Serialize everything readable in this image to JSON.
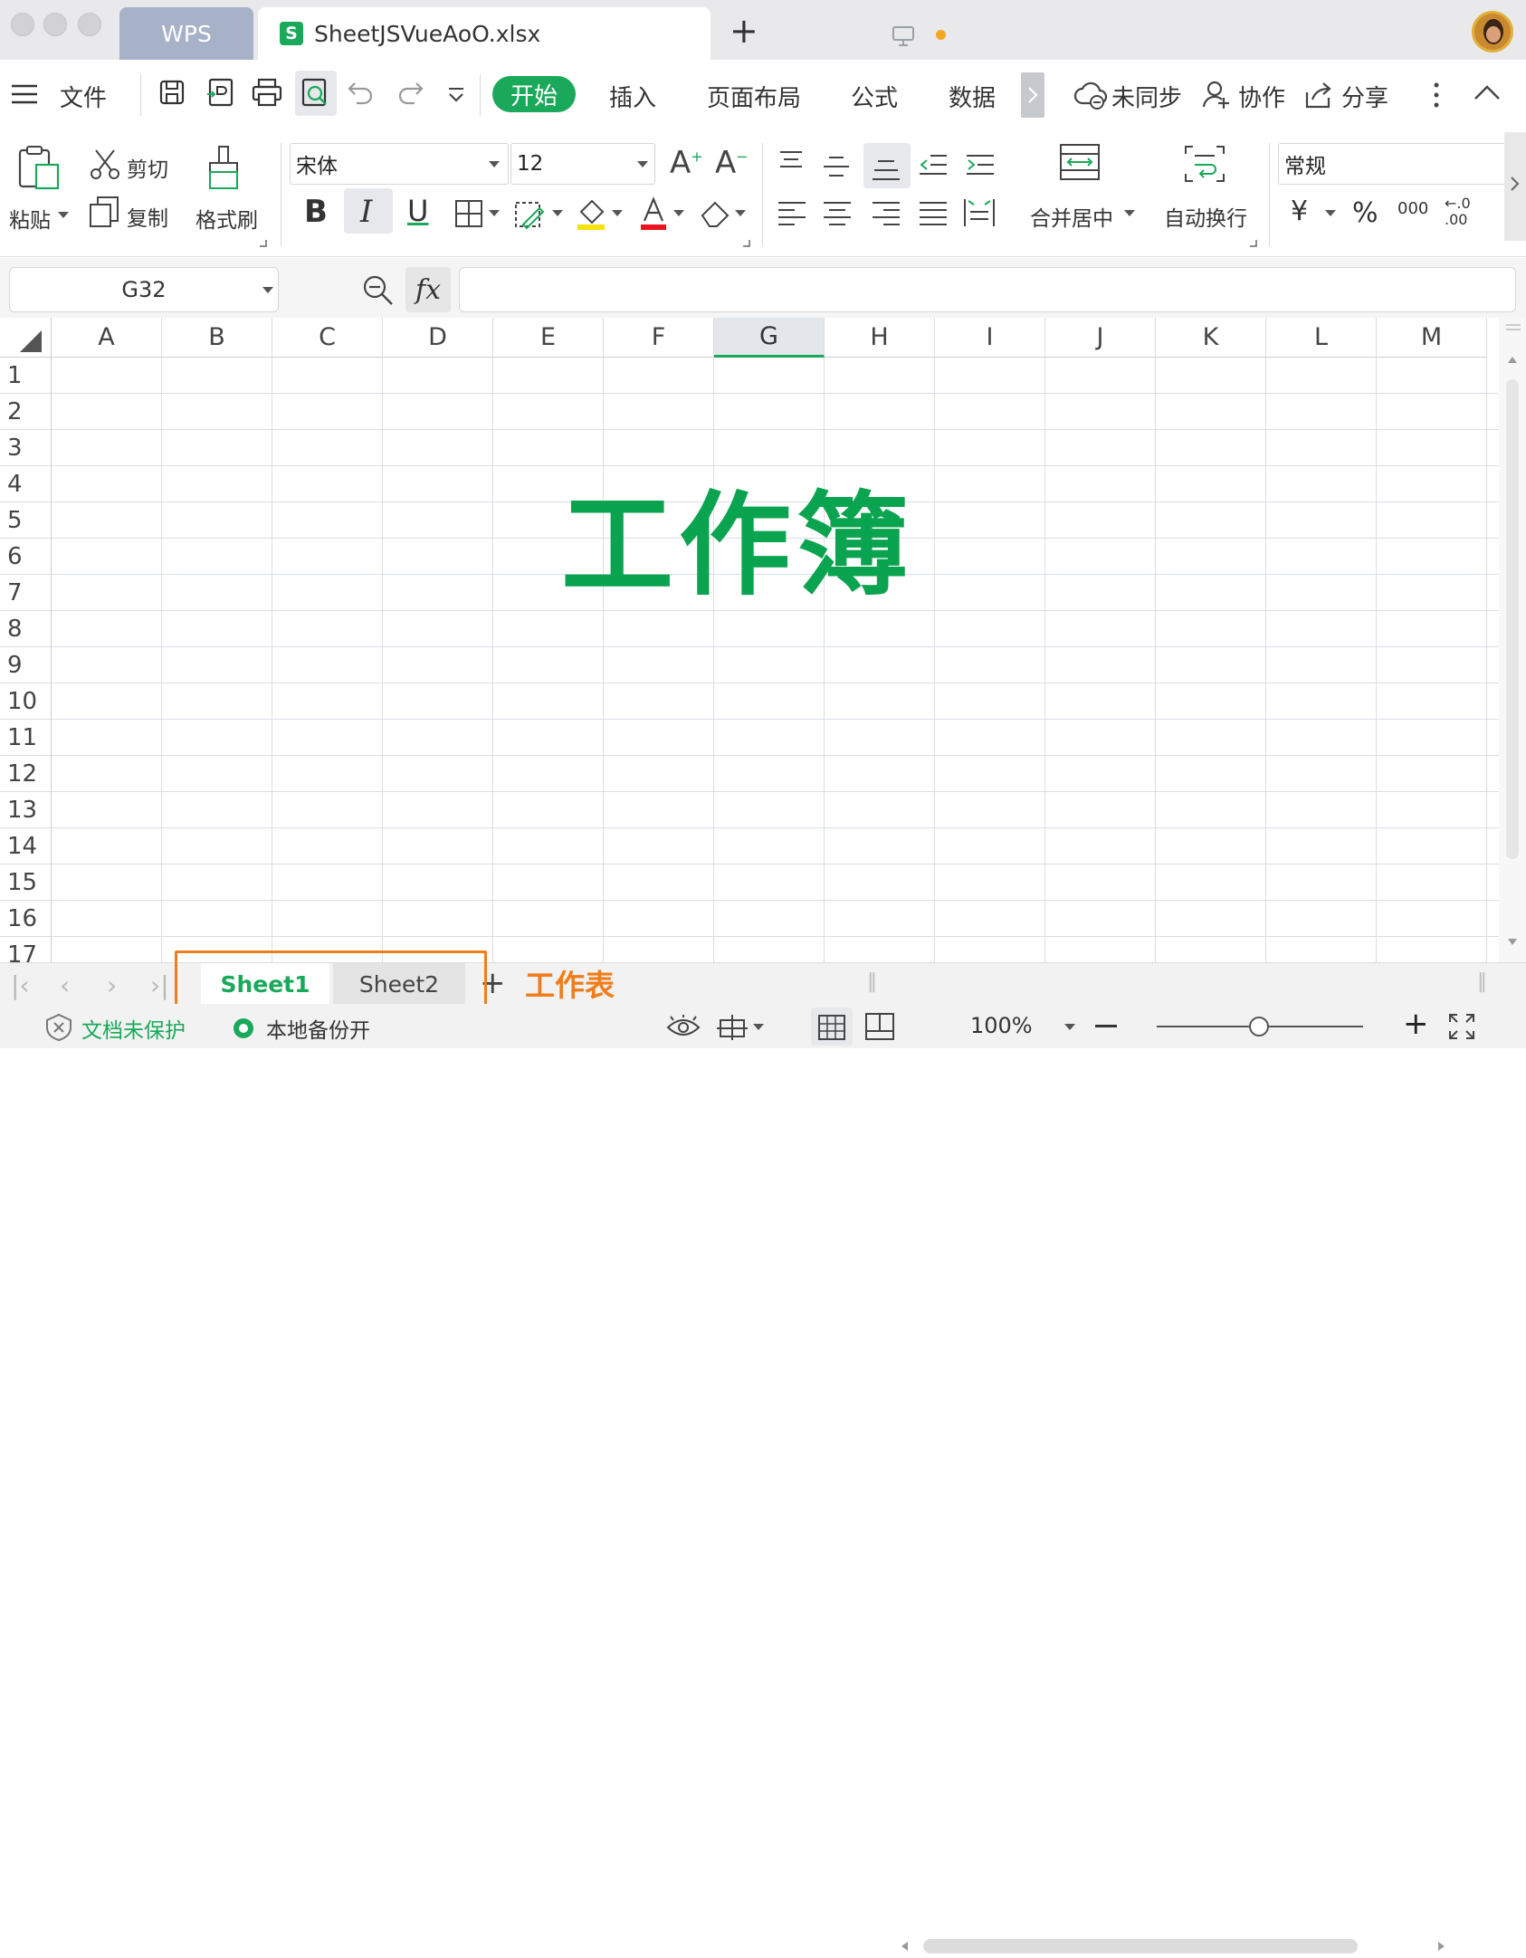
{
  "titlebar": {
    "wps_tab": "WPS",
    "doc_tab": "SheetJSVueAoO.xlsx",
    "doc_icon_letter": "S",
    "new_tab": "+"
  },
  "menu": {
    "file": "文件",
    "tabs": [
      "开始",
      "插入",
      "页面布局",
      "公式",
      "数据"
    ],
    "sync": "未同步",
    "collab": "协作",
    "share": "分享"
  },
  "ribbon": {
    "paste": "粘贴",
    "cut": "剪切",
    "copy": "复制",
    "format_painter": "格式刷",
    "font_name": "宋体",
    "font_size": "12",
    "bold": "B",
    "italic": "I",
    "underline": "U",
    "merge_center": "合并居中",
    "wrap_text": "自动换行",
    "number_format": "常规",
    "currency": "¥",
    "percent": "%",
    "thousands": "000",
    "decimal": "←.0 .00"
  },
  "formula": {
    "name_box": "G32",
    "fx": "fx",
    "content": ""
  },
  "sheet": {
    "columns": [
      "A",
      "B",
      "C",
      "D",
      "E",
      "F",
      "G",
      "H",
      "I",
      "J",
      "K",
      "L",
      "M"
    ],
    "active_column": "G",
    "rows": [
      "1",
      "2",
      "3",
      "4",
      "5",
      "6",
      "7",
      "8",
      "9",
      "10",
      "11",
      "12",
      "13",
      "14",
      "15",
      "16",
      "17"
    ],
    "overlay_title": "工作簿"
  },
  "sheet_tabs": {
    "tabs": [
      "Sheet1",
      "Sheet2"
    ],
    "active": "Sheet1",
    "add": "+",
    "annotation": "工作表"
  },
  "status": {
    "protect": "文档未保护",
    "backup": "本地备份开",
    "zoom": "100%"
  },
  "colors": {
    "accent": "#1aa85a",
    "overlay_title": "#0aa34f",
    "annotation": "#f07d1c"
  }
}
